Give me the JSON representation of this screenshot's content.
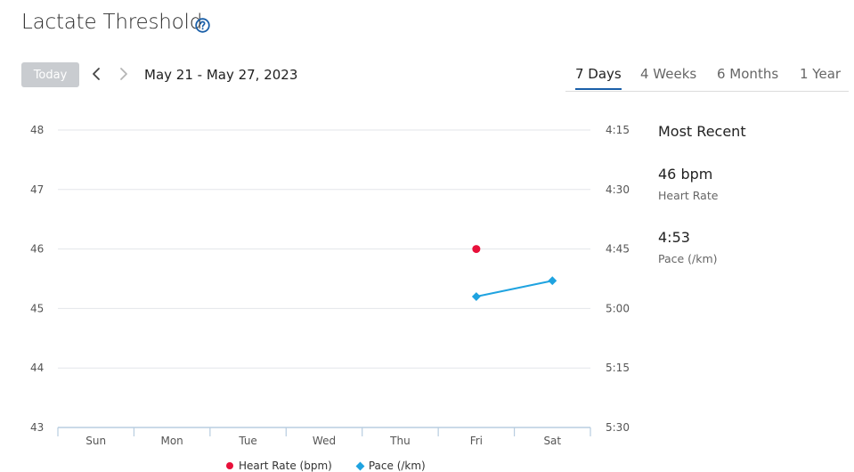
{
  "header": {
    "title": "Lactate Threshold",
    "help_icon": "question-circle-icon"
  },
  "toolbar": {
    "today_label": "Today",
    "prev_icon": "chevron-left-icon",
    "next_icon": "chevron-right-icon",
    "date_range": "May 21 - May 27, 2023"
  },
  "tabs": [
    {
      "label": "7 Days",
      "active": true
    },
    {
      "label": "4 Weeks",
      "active": false
    },
    {
      "label": "6 Months",
      "active": false
    },
    {
      "label": "1 Year",
      "active": false
    }
  ],
  "colors": {
    "accent": "#1a5fa8",
    "heart_rate": "#e8103a",
    "pace": "#1fa3e0",
    "grid": "#e3e6ea",
    "axis": "#b8cde0"
  },
  "most_recent": {
    "title": "Most Recent",
    "heart_rate_value": "46 bpm",
    "heart_rate_label": "Heart Rate",
    "pace_value": "4:53",
    "pace_label": "Pace (/km)"
  },
  "legend": {
    "heart_rate": "Heart Rate (bpm)",
    "pace": "Pace (/km)"
  },
  "chart_data": {
    "type": "line",
    "categories": [
      "Sun",
      "Mon",
      "Tue",
      "Wed",
      "Thu",
      "Fri",
      "Sat"
    ],
    "grid": true,
    "legend_position": "bottom",
    "y_left": {
      "ticks": [
        "43",
        "44",
        "45",
        "46",
        "47",
        "48"
      ],
      "ylim": [
        43,
        48
      ]
    },
    "y_right": {
      "ticks": [
        "4:15",
        "4:30",
        "4:45",
        "5:00",
        "5:15",
        "5:30"
      ],
      "reversed": true,
      "ylim": [
        "4:15",
        "5:30"
      ]
    },
    "series": [
      {
        "name": "Heart Rate (bpm)",
        "axis": "left",
        "marker": "circle",
        "values": [
          null,
          null,
          null,
          null,
          null,
          46,
          null
        ]
      },
      {
        "name": "Pace (/km)",
        "axis": "right",
        "marker": "diamond",
        "values": [
          null,
          null,
          null,
          null,
          null,
          "4:57",
          "4:53"
        ]
      }
    ]
  }
}
